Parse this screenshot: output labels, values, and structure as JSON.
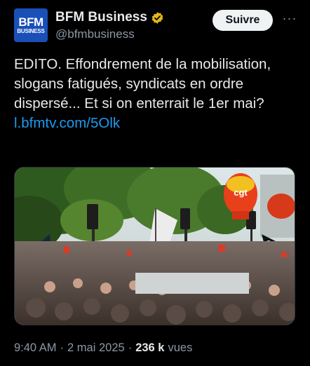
{
  "account": {
    "avatar_line1": "BFM",
    "avatar_line2": "BUSINESS",
    "display_name": "BFM Business",
    "handle": "@bfmbusiness",
    "verified_color": "#e2b719"
  },
  "actions": {
    "follow_label": "Suivre",
    "more_label": "···"
  },
  "tweet": {
    "text": "EDITO. Effondrement de la mobilisation, slogans fatigués, syndicats en ordre dispersé... Et si on enterrait le 1er mai?",
    "link": "l.bfmtv.com/5Olk"
  },
  "media": {
    "balloon_text": "cgt",
    "icon": "crowd-protest-photo"
  },
  "meta": {
    "time": "9:40 AM",
    "separator": "·",
    "date": "2 mai 2025",
    "separator2": "·",
    "views_count": "236 k",
    "views_label": "vues"
  },
  "colors": {
    "background": "#000000",
    "link": "#1d9bf0",
    "secondary_text": "#8b98a5",
    "brand_blue": "#1a4fb8"
  }
}
